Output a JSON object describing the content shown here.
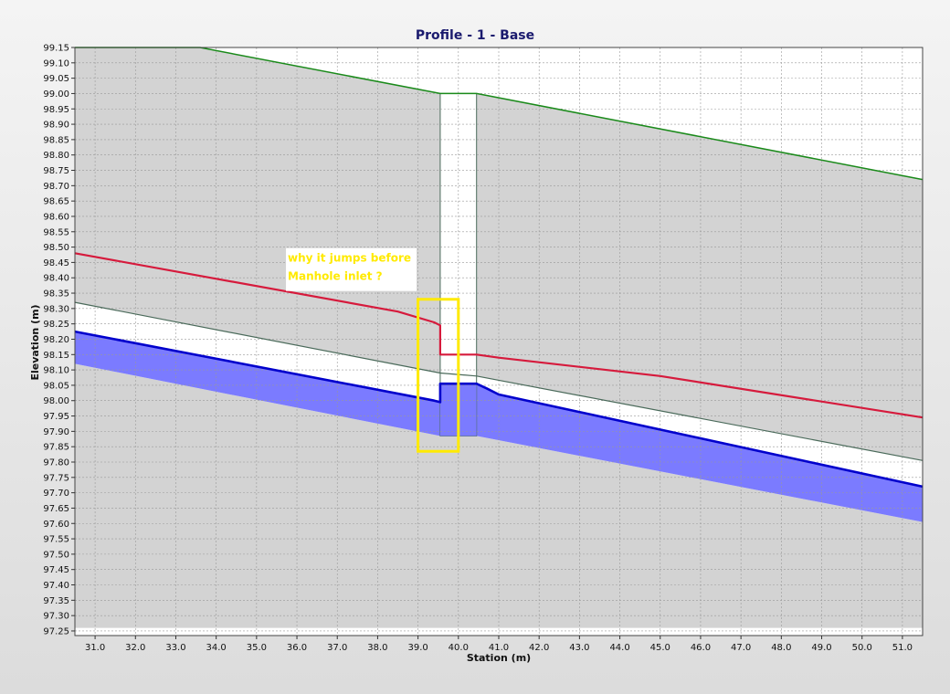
{
  "chart_data": {
    "type": "line",
    "title": "Profile - 1 - Base",
    "xlabel": "Station (m)",
    "ylabel": "Elevation (m)",
    "xlim": [
      30.5,
      51.5
    ],
    "ylim": [
      97.235,
      99.15
    ],
    "x_ticks": [
      31,
      32,
      33,
      34,
      35,
      36,
      37,
      38,
      39,
      40,
      41,
      42,
      43,
      44,
      45,
      46,
      47,
      48,
      49,
      50,
      51
    ],
    "y_ticks": [
      97.25,
      97.3,
      97.35,
      97.4,
      97.45,
      97.5,
      97.55,
      97.6,
      97.65,
      97.7,
      97.75,
      97.8,
      97.85,
      97.9,
      97.95,
      98.0,
      98.05,
      98.1,
      98.15,
      98.2,
      98.25,
      98.3,
      98.35,
      98.4,
      98.45,
      98.5,
      98.55,
      98.6,
      98.65,
      98.7,
      98.75,
      98.8,
      98.85,
      98.9,
      98.95,
      99.0,
      99.05,
      99.1,
      99.15
    ],
    "grid": true,
    "manhole": {
      "x_start": 39.55,
      "x_end": 40.45,
      "rim": 99.0,
      "invert": 97.885
    },
    "series": [
      {
        "role": "ground",
        "color": "#1a8a1a",
        "x": [
          30.5,
          33.6,
          39.55,
          40.45,
          51.5
        ],
        "y": [
          99.26,
          99.15,
          99.0,
          99.0,
          98.72
        ]
      },
      {
        "role": "hgl",
        "color": "#d61a3c",
        "x": [
          30.5,
          38.5,
          39.4,
          39.55,
          39.55,
          40.45,
          41.0,
          45.0,
          51.5
        ],
        "y": [
          98.48,
          98.29,
          98.255,
          98.245,
          98.15,
          98.15,
          98.14,
          98.08,
          97.945
        ]
      },
      {
        "role": "pipe-crown",
        "color": "#4a6a5a",
        "x": [
          30.5,
          39.55,
          40.45,
          51.5
        ],
        "y": [
          98.32,
          98.09,
          98.08,
          97.805
        ]
      },
      {
        "role": "water-surface",
        "color": "#0000cc",
        "x": [
          30.5,
          39.4,
          39.55,
          39.55,
          40.45,
          40.7,
          41.0,
          51.5
        ],
        "y": [
          98.225,
          98.0,
          97.995,
          98.055,
          98.055,
          98.04,
          98.02,
          97.72
        ]
      },
      {
        "role": "pipe-invert",
        "color": "#6a6aff",
        "x": [
          30.5,
          39.55,
          40.45,
          51.5
        ],
        "y": [
          98.12,
          97.885,
          97.885,
          97.605
        ]
      }
    ],
    "annotations": [
      {
        "lines": [
          "why it jumps before",
          "Manhole inlet ?"
        ],
        "x": 36.0,
        "y": 98.47
      }
    ],
    "highlight_box": {
      "x0": 39.0,
      "x1": 40.0,
      "y0": 97.835,
      "y1": 98.33,
      "color": "#ffea00"
    }
  }
}
